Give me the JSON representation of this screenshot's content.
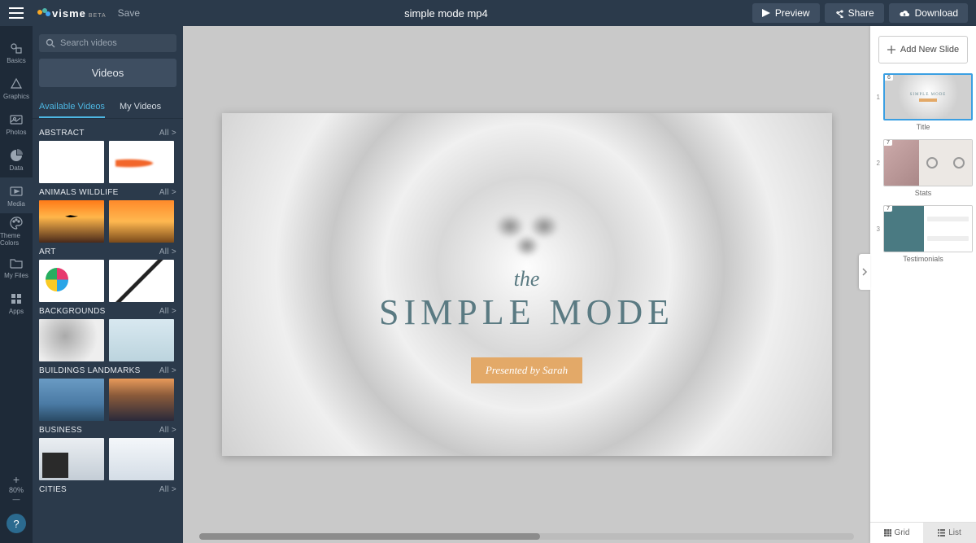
{
  "topbar": {
    "logo_text": "visme",
    "logo_beta": "BETA",
    "save": "Save",
    "title": "simple mode mp4",
    "preview": "Preview",
    "share": "Share",
    "download": "Download"
  },
  "rail": {
    "items": [
      {
        "label": "Basics",
        "icon": "shapes"
      },
      {
        "label": "Graphics",
        "icon": "graphics"
      },
      {
        "label": "Photos",
        "icon": "photos"
      },
      {
        "label": "Data",
        "icon": "pie"
      },
      {
        "label": "Media",
        "icon": "media",
        "active": true
      },
      {
        "label": "Theme Colors",
        "icon": "palette"
      },
      {
        "label": "My Files",
        "icon": "folder"
      },
      {
        "label": "Apps",
        "icon": "apps"
      }
    ],
    "zoom_plus": "+",
    "zoom_pct": "80%",
    "zoom_minus": "—",
    "help": "?"
  },
  "panel": {
    "search_placeholder": "Search videos",
    "videos_btn": "Videos",
    "tabs": [
      {
        "label": "Available Videos",
        "active": true
      },
      {
        "label": "My Videos"
      }
    ],
    "all_label": "All >",
    "categories": [
      {
        "name": "ABSTRACT",
        "thumbs": [
          "t-petals",
          "t-ink"
        ]
      },
      {
        "name": "ANIMALS WILDLIFE",
        "thumbs": [
          "t-sunset",
          "t-eleph"
        ]
      },
      {
        "name": "ART",
        "thumbs": [
          "t-paint",
          "t-brush"
        ]
      },
      {
        "name": "BACKGROUNDS",
        "thumbs": [
          "t-smoke",
          "t-arctic"
        ]
      },
      {
        "name": "BUILDINGS LANDMARKS",
        "thumbs": [
          "t-bridge",
          "t-city"
        ]
      },
      {
        "name": "BUSINESS",
        "thumbs": [
          "t-office",
          "t-office2"
        ]
      },
      {
        "name": "CITIES",
        "thumbs": []
      }
    ]
  },
  "slide": {
    "the": "the",
    "heading": "SIMPLE MODE",
    "badge": "Presented by Sarah"
  },
  "right": {
    "add": "Add New Slide",
    "slides": [
      {
        "num": "1",
        "corner": "6",
        "label": "Title",
        "selected": true,
        "cls": "st-title"
      },
      {
        "num": "2",
        "corner": "7",
        "label": "Stats",
        "cls": "st-stats"
      },
      {
        "num": "3",
        "corner": "7",
        "label": "Testimonials",
        "cls": "st-test"
      }
    ],
    "grid": "Grid",
    "list": "List"
  }
}
